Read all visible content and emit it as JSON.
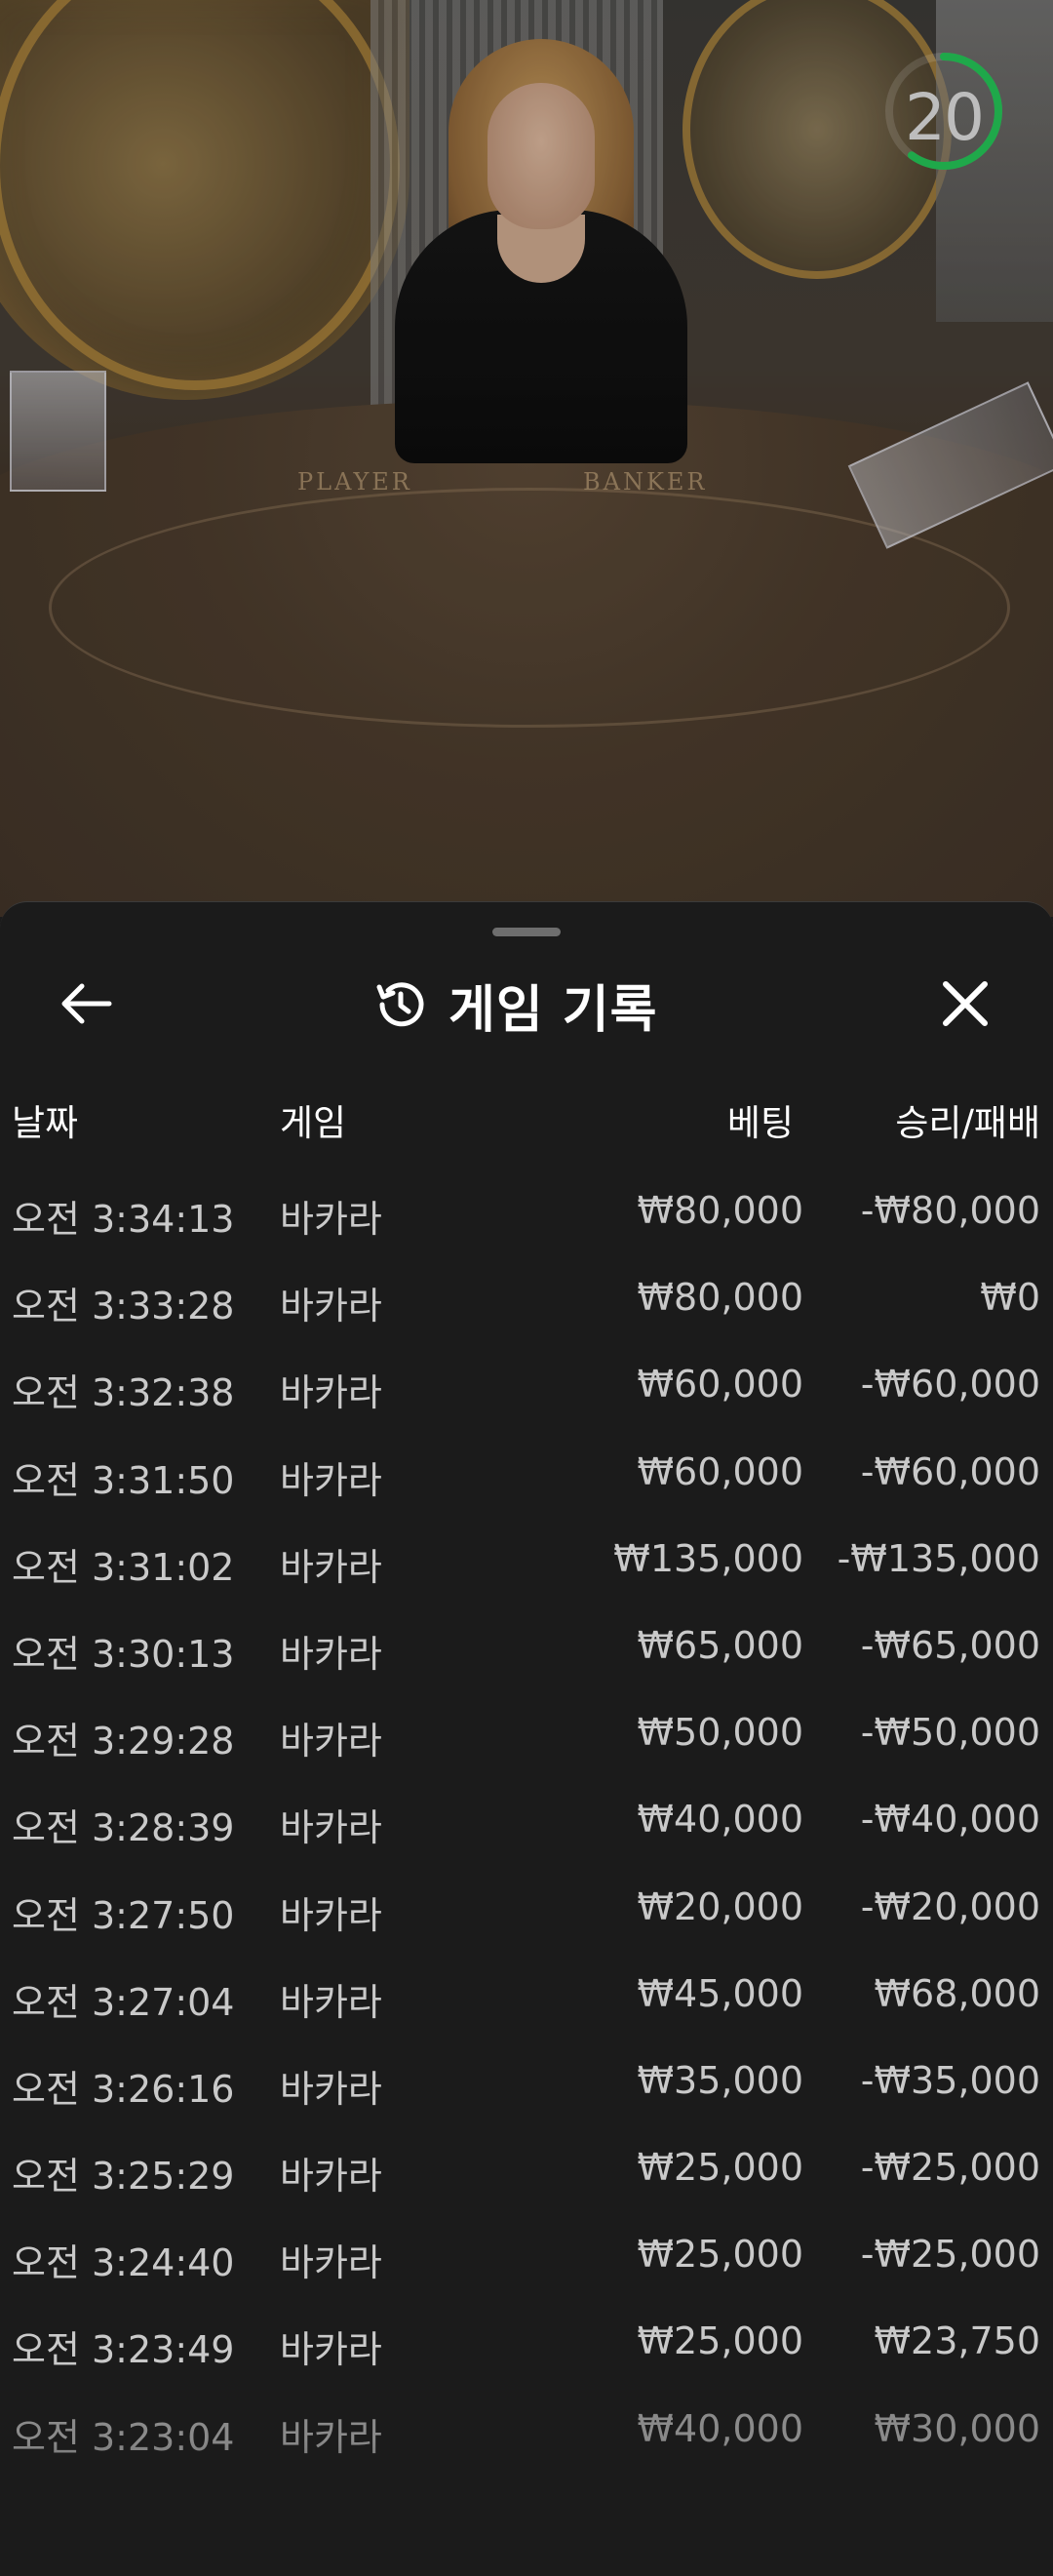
{
  "timer": {
    "value": "20",
    "progress": 0.6,
    "color": "#1fa84a"
  },
  "sheet": {
    "title": "게임 기록",
    "icons": {
      "back": "arrow-left-icon",
      "history": "history-clock-icon",
      "close": "close-icon"
    }
  },
  "table": {
    "columns": [
      "날짜",
      "게임",
      "베팅",
      "승리/패배"
    ],
    "rows": [
      {
        "date": "오전 3:34:13",
        "game": "바카라",
        "bet": "₩80,000",
        "result": "-₩80,000"
      },
      {
        "date": "오전 3:33:28",
        "game": "바카라",
        "bet": "₩80,000",
        "result": "₩0"
      },
      {
        "date": "오전 3:32:38",
        "game": "바카라",
        "bet": "₩60,000",
        "result": "-₩60,000"
      },
      {
        "date": "오전 3:31:50",
        "game": "바카라",
        "bet": "₩60,000",
        "result": "-₩60,000"
      },
      {
        "date": "오전 3:31:02",
        "game": "바카라",
        "bet": "₩135,000",
        "result": "-₩135,000"
      },
      {
        "date": "오전 3:30:13",
        "game": "바카라",
        "bet": "₩65,000",
        "result": "-₩65,000"
      },
      {
        "date": "오전 3:29:28",
        "game": "바카라",
        "bet": "₩50,000",
        "result": "-₩50,000"
      },
      {
        "date": "오전 3:28:39",
        "game": "바카라",
        "bet": "₩40,000",
        "result": "-₩40,000"
      },
      {
        "date": "오전 3:27:50",
        "game": "바카라",
        "bet": "₩20,000",
        "result": "-₩20,000"
      },
      {
        "date": "오전 3:27:04",
        "game": "바카라",
        "bet": "₩45,000",
        "result": "₩68,000"
      },
      {
        "date": "오전 3:26:16",
        "game": "바카라",
        "bet": "₩35,000",
        "result": "-₩35,000"
      },
      {
        "date": "오전 3:25:29",
        "game": "바카라",
        "bet": "₩25,000",
        "result": "-₩25,000"
      },
      {
        "date": "오전 3:24:40",
        "game": "바카라",
        "bet": "₩25,000",
        "result": "-₩25,000"
      },
      {
        "date": "오전 3:23:49",
        "game": "바카라",
        "bet": "₩25,000",
        "result": "₩23,750"
      },
      {
        "date": "오전 3:23:04",
        "game": "바카라",
        "bet": "₩40,000",
        "result": "₩30,000"
      }
    ]
  },
  "video": {
    "table_labels": {
      "player": "PLAYER",
      "banker": "BANKER"
    }
  }
}
